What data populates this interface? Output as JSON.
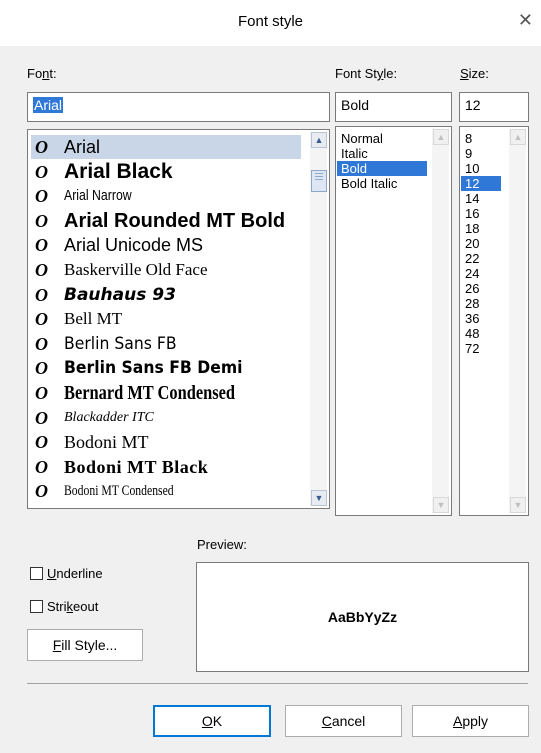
{
  "dialog": {
    "title": "Font style",
    "close_glyph": "✕"
  },
  "font": {
    "label": "Font:",
    "value": "Arial",
    "items": [
      {
        "name": "Arial"
      },
      {
        "name": "Arial Black"
      },
      {
        "name": "Arial Narrow"
      },
      {
        "name": "Arial Rounded MT Bold"
      },
      {
        "name": "Arial Unicode MS"
      },
      {
        "name": "Baskerville Old Face"
      },
      {
        "name": "Bauhaus 93"
      },
      {
        "name": "Bell MT"
      },
      {
        "name": "Berlin Sans FB"
      },
      {
        "name": "Berlin Sans FB Demi"
      },
      {
        "name": "Bernard MT Condensed"
      },
      {
        "name": "Blackadder ITC"
      },
      {
        "name": "Bodoni MT"
      },
      {
        "name": "Bodoni MT Black"
      },
      {
        "name": "Bodoni MT Condensed"
      }
    ],
    "item_icon": "O"
  },
  "font_style": {
    "label": "Font Style:",
    "value": "Bold",
    "items": [
      "Normal",
      "Italic",
      "Bold",
      "Bold Italic"
    ]
  },
  "size": {
    "label": "Size:",
    "value": "12",
    "items": [
      "8",
      "9",
      "10",
      "12",
      "14",
      "16",
      "18",
      "20",
      "22",
      "24",
      "26",
      "28",
      "36",
      "48",
      "72"
    ]
  },
  "preview": {
    "label": "Preview:",
    "sample": "AaBbYyZz"
  },
  "effects": {
    "underline": "Underline",
    "strikeout": "Strikeout"
  },
  "buttons": {
    "fill_style": "Fill Style...",
    "ok": "OK",
    "cancel": "Cancel",
    "apply": "Apply"
  },
  "colors": {
    "selection": "#3078d8",
    "hover": "#c8d6e8",
    "default_border": "#0078d7"
  }
}
